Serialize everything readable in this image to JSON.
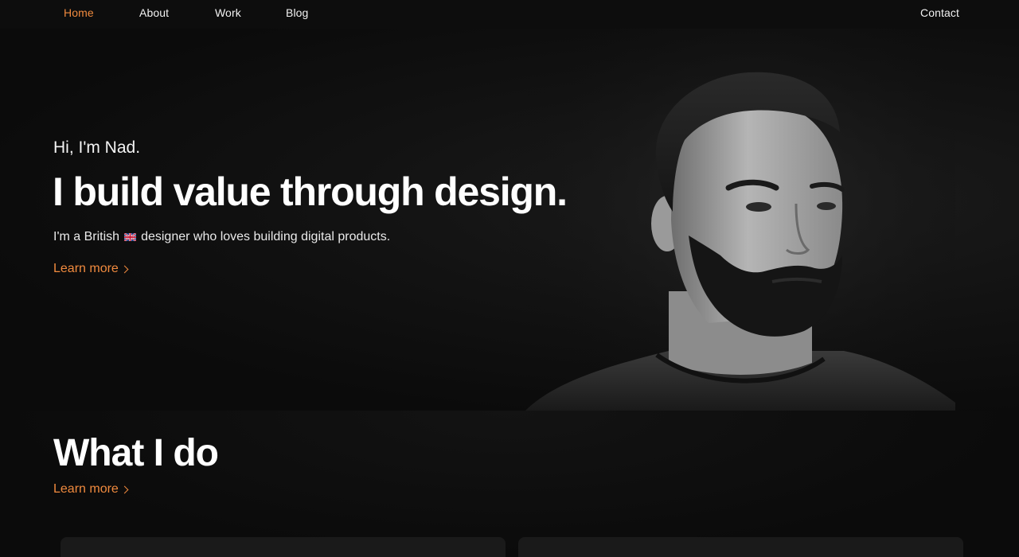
{
  "nav": {
    "items": [
      {
        "label": "Home",
        "active": true
      },
      {
        "label": "About",
        "active": false
      },
      {
        "label": "Work",
        "active": false
      },
      {
        "label": "Blog",
        "active": false
      }
    ],
    "contact_label": "Contact"
  },
  "hero": {
    "greeting": "Hi, I'm Nad.",
    "title": "I build value through design.",
    "subtitle_before": "I'm a British",
    "subtitle_after": "designer who loves building digital products.",
    "flag_icon": "uk-flag-icon",
    "learn_more": "Learn more"
  },
  "what_i_do": {
    "title": "What I do",
    "learn_more": "Learn more"
  },
  "colors": {
    "accent": "#f08a3e",
    "background": "#0b0b0b",
    "card": "#1a1a1a"
  }
}
